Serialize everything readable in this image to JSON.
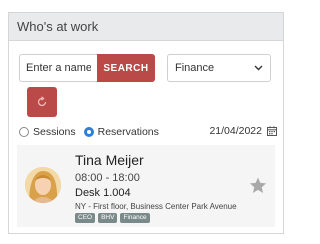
{
  "header": {
    "title": "Who's at work"
  },
  "search": {
    "placeholder": "Enter a name",
    "button_label": "SEARCH"
  },
  "filter": {
    "selected": "Finance"
  },
  "view_toggle": {
    "options": [
      {
        "label": "Sessions",
        "checked": false
      },
      {
        "label": "Reservations",
        "checked": true
      }
    ]
  },
  "date": "21/04/2022",
  "reservation": {
    "name": "Tina Meijer",
    "time": "08:00 - 18:00",
    "desk": "Desk 1.004",
    "location": "NY - First floor, Business Center Park Avenue",
    "tags": [
      "CEO",
      "BHV",
      "Finance"
    ],
    "favorite": false
  },
  "colors": {
    "accent": "#b94a48",
    "radio_selected": "#2f7fd9",
    "header_bg": "#e9eaec",
    "tag_bg": "#7a8a8a"
  },
  "icons": {
    "refresh": "refresh-icon",
    "calendar": "calendar-icon",
    "select": "chevron-down-icon",
    "favorite": "star-icon"
  }
}
